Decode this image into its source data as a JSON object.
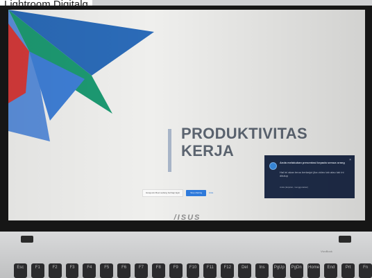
{
  "caption": "Lightroom Digitalg",
  "slide": {
    "title_line1": "PRODUKTIVITAS",
    "title_line2": "KERJA"
  },
  "share_bar": {
    "message": "Hangouts Meet sedang berbagi layar",
    "stop_label": "Stop sharing",
    "hide_label": "Hide"
  },
  "toast": {
    "title": "Anda melakukan presentasi kepada semua orang",
    "body": "Hal ini akan terus berlanjut jika video tab atau tab ini ditutup",
    "link": "Anda (lanjutan, menggunakan)",
    "close": "×"
  },
  "brand": "/ISUS",
  "deck_sticker": "VivoBook",
  "keys": [
    "Esc",
    "F1",
    "F2",
    "F3",
    "F4",
    "F5",
    "F6",
    "F7",
    "F8",
    "F9",
    "F10",
    "F11",
    "F12",
    "Del",
    "Ins",
    "PgUp",
    "PgDn",
    "Home",
    "End",
    "Prt",
    "Fn"
  ],
  "colors": {
    "title": "#5d6672",
    "share_stop": "#2f7de1",
    "toast_bg": "#1f2d4a"
  }
}
